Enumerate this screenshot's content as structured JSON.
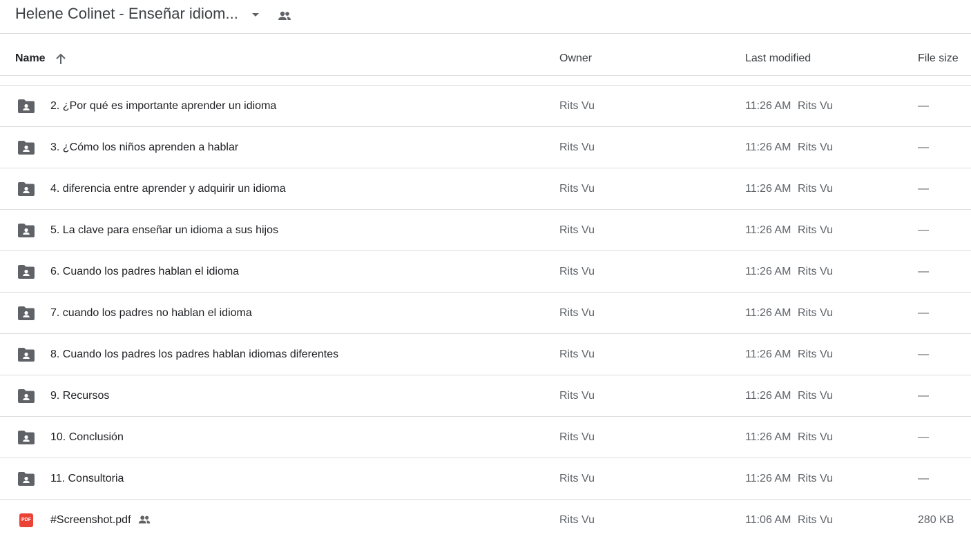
{
  "header": {
    "title": "Helene Colinet - Enseñar idiom...",
    "dropdown_icon": "arrow-drop-down-icon",
    "shared_icon": "people-icon"
  },
  "columns": {
    "name": "Name",
    "sort_icon": "arrow-upward-icon",
    "owner": "Owner",
    "last_modified": "Last modified",
    "file_size": "File size"
  },
  "colors": {
    "folder_icon": "#5f6368",
    "pdf_icon": "#ea4335",
    "divider": "#dadce0"
  },
  "rows": [
    {
      "type": "shared-folder",
      "icon": "shared-folder-icon",
      "name": "2. ¿Por qué es importante aprender un idioma",
      "owner": "Rits Vu",
      "modified_time": "11:26 AM",
      "modified_by": "Rits Vu",
      "size": "—"
    },
    {
      "type": "shared-folder",
      "icon": "shared-folder-icon",
      "name": "3. ¿Cómo los niños aprenden a hablar",
      "owner": "Rits Vu",
      "modified_time": "11:26 AM",
      "modified_by": "Rits Vu",
      "size": "—"
    },
    {
      "type": "shared-folder",
      "icon": "shared-folder-icon",
      "name": "4. diferencia entre aprender y adquirir un idioma",
      "owner": "Rits Vu",
      "modified_time": "11:26 AM",
      "modified_by": "Rits Vu",
      "size": "—"
    },
    {
      "type": "shared-folder",
      "icon": "shared-folder-icon",
      "name": "5. La clave para enseñar un idioma a sus hijos",
      "owner": "Rits Vu",
      "modified_time": "11:26 AM",
      "modified_by": "Rits Vu",
      "size": "—"
    },
    {
      "type": "shared-folder",
      "icon": "shared-folder-icon",
      "name": "6. Cuando los padres hablan el idioma",
      "owner": "Rits Vu",
      "modified_time": "11:26 AM",
      "modified_by": "Rits Vu",
      "size": "—"
    },
    {
      "type": "shared-folder",
      "icon": "shared-folder-icon",
      "name": "7. cuando los padres no hablan el idioma",
      "owner": "Rits Vu",
      "modified_time": "11:26 AM",
      "modified_by": "Rits Vu",
      "size": "—"
    },
    {
      "type": "shared-folder",
      "icon": "shared-folder-icon",
      "name": "8. Cuando los padres los padres hablan idiomas diferentes",
      "owner": "Rits Vu",
      "modified_time": "11:26 AM",
      "modified_by": "Rits Vu",
      "size": "—"
    },
    {
      "type": "shared-folder",
      "icon": "shared-folder-icon",
      "name": "9. Recursos",
      "owner": "Rits Vu",
      "modified_time": "11:26 AM",
      "modified_by": "Rits Vu",
      "size": "—"
    },
    {
      "type": "shared-folder",
      "icon": "shared-folder-icon",
      "name": "10. Conclusión",
      "owner": "Rits Vu",
      "modified_time": "11:26 AM",
      "modified_by": "Rits Vu",
      "size": "—"
    },
    {
      "type": "shared-folder",
      "icon": "shared-folder-icon",
      "name": "11. Consultoria",
      "owner": "Rits Vu",
      "modified_time": "11:26 AM",
      "modified_by": "Rits Vu",
      "size": "—"
    },
    {
      "type": "pdf",
      "icon": "pdf-icon",
      "icon_label": "PDF",
      "name": "#Screenshot.pdf",
      "shared": true,
      "shared_icon": "people-icon",
      "owner": "Rits Vu",
      "modified_time": "11:06 AM",
      "modified_by": "Rits Vu",
      "size": "280 KB"
    }
  ]
}
